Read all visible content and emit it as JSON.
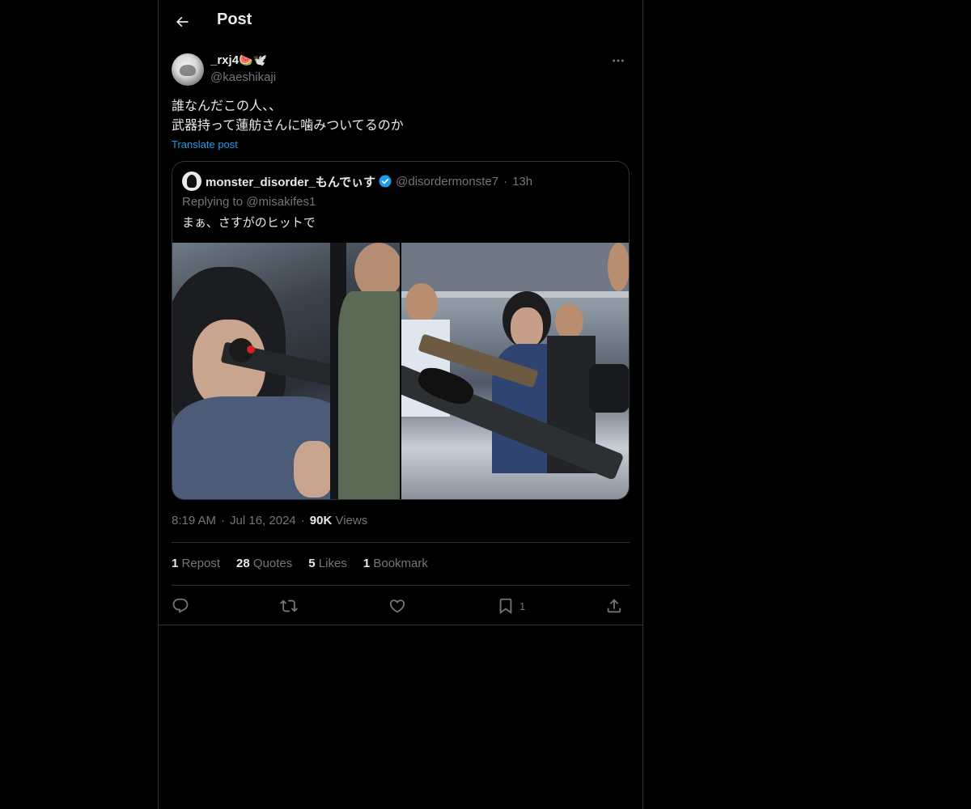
{
  "header": {
    "title": "Post"
  },
  "post": {
    "author": {
      "display_name": "_rxj4",
      "name_emoji": "🍉🕊️",
      "handle": "@kaeshikaji"
    },
    "text": "誰なんだこの人、、\n武器持って蓮舫さんに噛みついてるのか",
    "translate_label": "Translate post",
    "quote": {
      "display_name": "monster_disorder_もんでぃす",
      "handle": "@disordermonste7",
      "time": "13h",
      "reply_context": "Replying to @misakifes1",
      "text": "まぁ、さすがのヒットで"
    },
    "time": "8:19 AM",
    "date": "Jul 16, 2024",
    "views_count": "90K",
    "views_label": "Views",
    "stats": {
      "reposts_count": "1",
      "reposts_label": "Repost",
      "quotes_count": "28",
      "quotes_label": "Quotes",
      "likes_count": "5",
      "likes_label": "Likes",
      "bookmarks_count": "1",
      "bookmarks_label": "Bookmark"
    },
    "actions": {
      "bookmark_count": "1"
    }
  },
  "colors": {
    "background": "#000000",
    "text": "#e7e9ea",
    "muted": "#71767b",
    "accent": "#1d9bf0",
    "border": "#2f3336"
  },
  "icons": [
    "back-arrow-icon",
    "more-icon",
    "verified-badge-icon",
    "reply-icon",
    "repost-icon",
    "like-icon",
    "bookmark-icon",
    "share-icon"
  ]
}
